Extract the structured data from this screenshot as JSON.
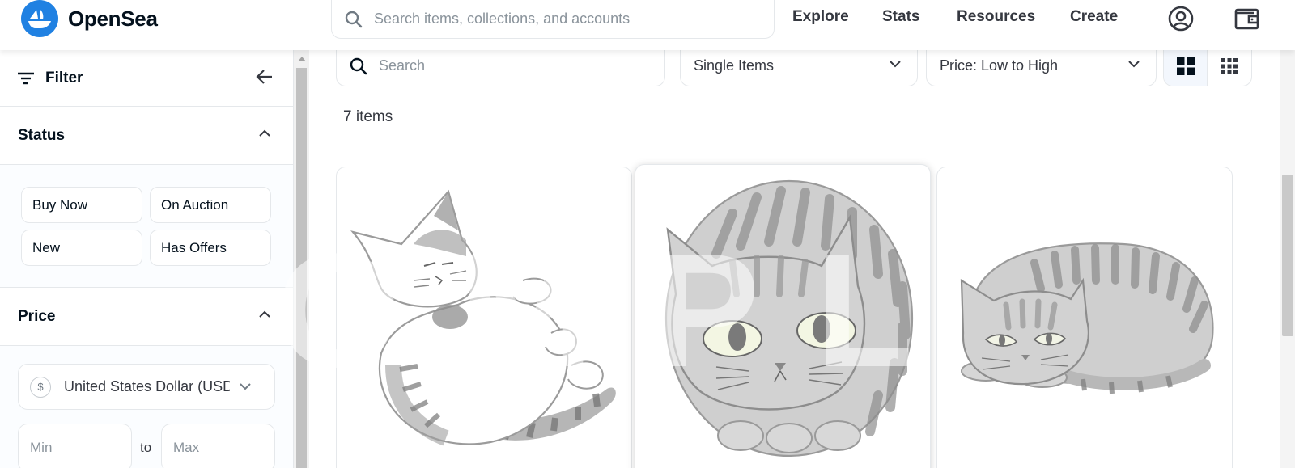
{
  "header": {
    "logo_text": "OpenSea",
    "search_placeholder": "Search items, collections, and accounts",
    "nav": [
      "Explore",
      "Stats",
      "Resources",
      "Create"
    ]
  },
  "sidebar": {
    "filter_label": "Filter",
    "status": {
      "title": "Status",
      "options": [
        "Buy Now",
        "On Auction",
        "New",
        "Has Offers"
      ]
    },
    "price": {
      "title": "Price",
      "currency": "United States Dollar (USD)",
      "min_placeholder": "Min",
      "max_placeholder": "Max",
      "to_label": "to"
    }
  },
  "main": {
    "search_placeholder": "Search",
    "item_type": "Single Items",
    "sort": "Price: Low to High",
    "item_count": "7 items",
    "cards": [
      {
        "image": "cat-lying-on-back"
      },
      {
        "image": "round-tabby-cat"
      },
      {
        "image": "crouching-tabby-cat"
      }
    ]
  },
  "colors": {
    "brand": "#2081e2",
    "text": "#04111d",
    "border": "#e5e8eb"
  }
}
